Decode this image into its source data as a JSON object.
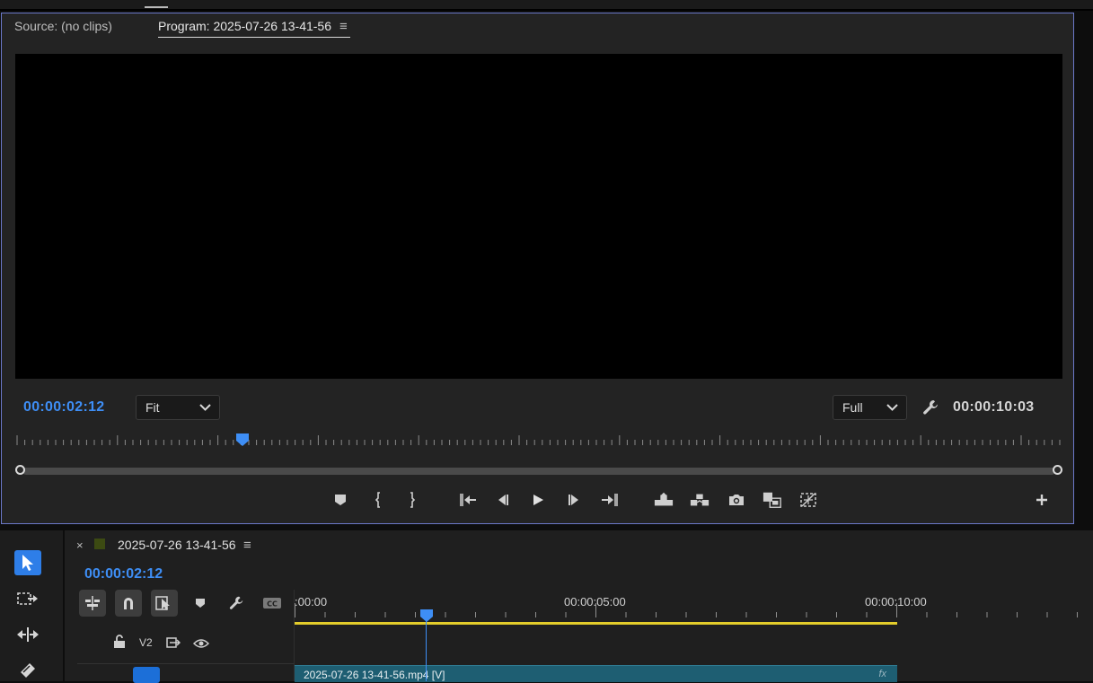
{
  "monitor": {
    "source_tab": "Source: (no clips)",
    "program_tab": "Program: 2025-07-26 13-41-56",
    "menu_glyph": "≡",
    "current_timecode": "00:00:02:12",
    "zoom_select": "Fit",
    "resolution_select": "Full",
    "duration_timecode": "00:00:10:03",
    "playhead_fraction": 0.214,
    "controls": [
      {
        "name": "add-marker-icon"
      },
      {
        "name": "mark-in-icon"
      },
      {
        "name": "mark-out-icon"
      },
      {
        "name": "go-to-in-icon"
      },
      {
        "name": "step-back-icon"
      },
      {
        "name": "play-icon"
      },
      {
        "name": "step-forward-icon"
      },
      {
        "name": "go-to-out-icon"
      },
      {
        "name": "lift-icon"
      },
      {
        "name": "extract-icon"
      },
      {
        "name": "export-frame-icon"
      },
      {
        "name": "comparison-view-icon"
      },
      {
        "name": "proxy-toggle-icon"
      },
      {
        "name": "button-editor-plus-icon"
      }
    ]
  },
  "tools": [
    "selection-tool-icon",
    "track-select-tool-icon",
    "ripple-edit-tool-icon",
    "razor-tool-icon"
  ],
  "timeline": {
    "close_glyph": "×",
    "sequence_title": "2025-07-26 13-41-56",
    "menu_glyph": "≡",
    "current_timecode": "00:00:02:12",
    "ruler_labels": [
      ":00:00",
      "00:00:05:00",
      "00:00:10:00"
    ],
    "track_v2": "V2",
    "clip_name": "2025-07-26 13-41-56.mp4 [V]",
    "clip_fx": "fx",
    "colors": {
      "accent": "#3e8ef5",
      "work_area": "#e3cc2b",
      "clip": "#1e5e72"
    }
  }
}
